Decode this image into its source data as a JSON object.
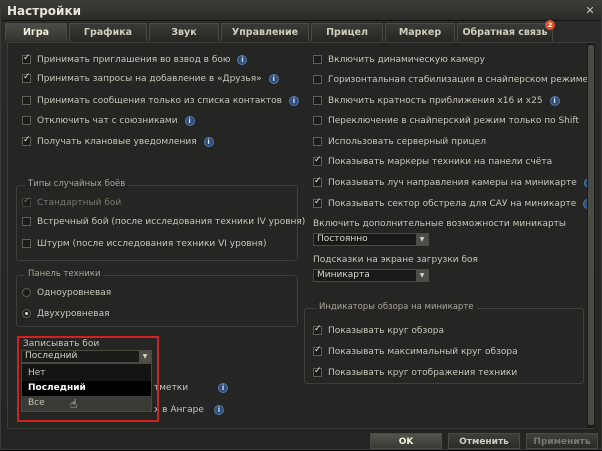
{
  "window": {
    "title": "Настройки",
    "close_glyph": "✕"
  },
  "tabs": [
    {
      "label": "Игра",
      "active": true
    },
    {
      "label": "Графика",
      "active": false
    },
    {
      "label": "Звук",
      "active": false
    },
    {
      "label": "Управление",
      "active": false
    },
    {
      "label": "Прицел",
      "active": false
    },
    {
      "label": "Маркер",
      "active": false
    },
    {
      "label": "Обратная связь",
      "active": false,
      "badge": "2"
    }
  ],
  "left": {
    "options": [
      {
        "label": "Принимать приглашения во взвод в бою",
        "checked": true,
        "info": true
      },
      {
        "label": "Принимать запросы на добавление в «Друзья»",
        "checked": true,
        "info": true
      },
      {
        "label": "Принимать сообщения только из списка контактов",
        "checked": false,
        "info": true
      },
      {
        "label": "Отключить чат с союзниками",
        "checked": false,
        "info": true
      },
      {
        "label": "Получать клановые уведомления",
        "checked": true,
        "info": true
      }
    ],
    "random_battle_types": {
      "title": "Типы случайных боёв",
      "items": [
        {
          "label": "Стандартный бой",
          "checked": true,
          "disabled": true
        },
        {
          "label": "Встречный бой (после исследования техники IV уровня)",
          "checked": false,
          "disabled": false
        },
        {
          "label": "Штурм (после исследования техники VI уровня)",
          "checked": false,
          "disabled": false
        }
      ]
    },
    "vehicle_panel": {
      "title": "Панель техники",
      "items": [
        {
          "label": "Одноуровневая",
          "selected": false
        },
        {
          "label": "Двухуровневая",
          "selected": true
        }
      ]
    },
    "record_battles": {
      "label": "Записывать бои",
      "value": "Последний",
      "options": [
        {
          "label": "Нет",
          "selected": false
        },
        {
          "label": "Последний",
          "selected": true
        },
        {
          "label": "Все",
          "selected": false,
          "hover": true
        }
      ]
    },
    "hidden_rows": [
      {
        "label_fragment": "тметки",
        "info": true
      },
      {
        "label_fragment": "х в Ангаре",
        "info": true
      }
    ]
  },
  "right": {
    "options": [
      {
        "label": "Включить динамическую камеру",
        "checked": false,
        "info": false
      },
      {
        "label": "Горизонтальная стабилизация в снайперском режиме",
        "checked": false,
        "info": false
      },
      {
        "label": "Включить кратность приближения x16 и x25",
        "checked": false,
        "info": true
      },
      {
        "label": "Переключение в снайперский режим только по Shift",
        "checked": false,
        "info": false
      },
      {
        "label": "Использовать серверный прицел",
        "checked": false,
        "info": false
      },
      {
        "label": "Показывать маркеры техники на панели счёта",
        "checked": true,
        "info": false
      },
      {
        "label": "Показывать луч направления камеры на миникарте",
        "checked": true,
        "info": true
      },
      {
        "label": "Показывать сектор обстрела для САУ на миникарте",
        "checked": true,
        "info": true
      }
    ],
    "minimap_features": {
      "label": "Включить дополнительные возможности миникарты",
      "value": "Постоянно"
    },
    "loading_hints": {
      "label": "Подсказки на экране загрузки боя",
      "value": "Миникарта"
    },
    "minimap_indicators": {
      "title": "Индикаторы обзора на миникарте",
      "items": [
        {
          "label": "Показывать круг обзора",
          "checked": true
        },
        {
          "label": "Показывать максимальный круг обзора",
          "checked": true
        },
        {
          "label": "Показывать круг отображения техники",
          "checked": true
        }
      ]
    }
  },
  "buttons": {
    "ok": "OK",
    "cancel": "Отменить",
    "apply": "Применить"
  },
  "info_glyph": "i"
}
